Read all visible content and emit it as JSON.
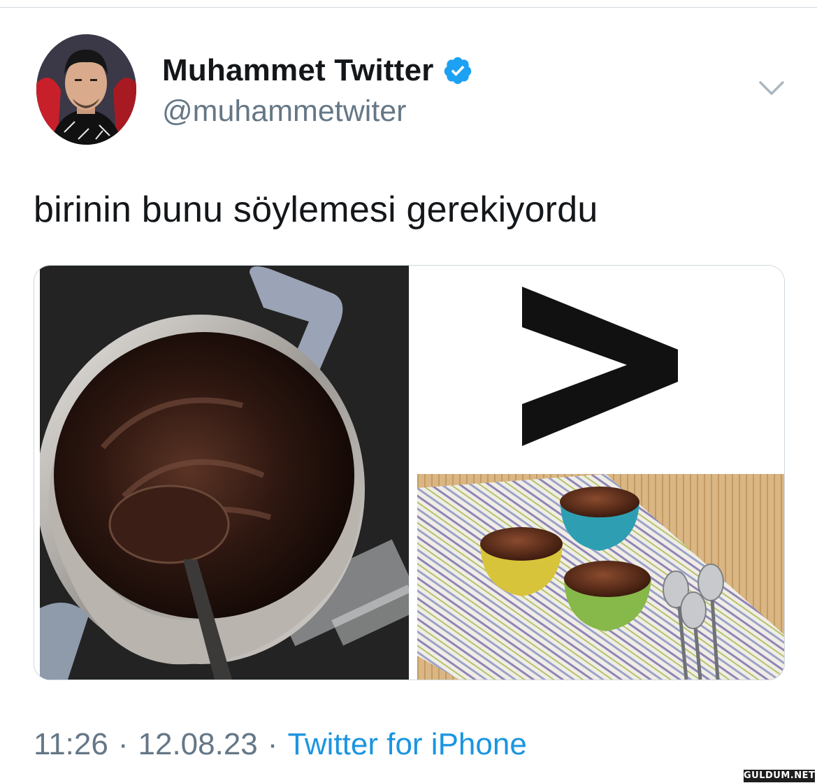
{
  "tweet": {
    "author": {
      "display_name": "Muhammet Twitter",
      "handle": "@muhammetwiter",
      "verified": true,
      "verified_badge_color": "#1da1f2"
    },
    "text": "birinin bunu söylemesi gerekiyordu",
    "media": {
      "images": [
        {
          "name": "chocolate-pot-photo"
        },
        {
          "name": "greater-than-sign",
          "symbol": ">"
        },
        {
          "name": "pudding-bowls-photo"
        }
      ]
    },
    "meta": {
      "time": "11:26",
      "separator": "·",
      "date": "12.08.23",
      "source": "Twitter for iPhone"
    }
  },
  "colors": {
    "secondary_text": "#657786",
    "link": "#1b95e0",
    "primary_text": "#14171a"
  },
  "icons": [
    "verified-badge-icon",
    "chevron-down-icon"
  ],
  "watermark": {
    "text": "GULDUM.NET"
  }
}
